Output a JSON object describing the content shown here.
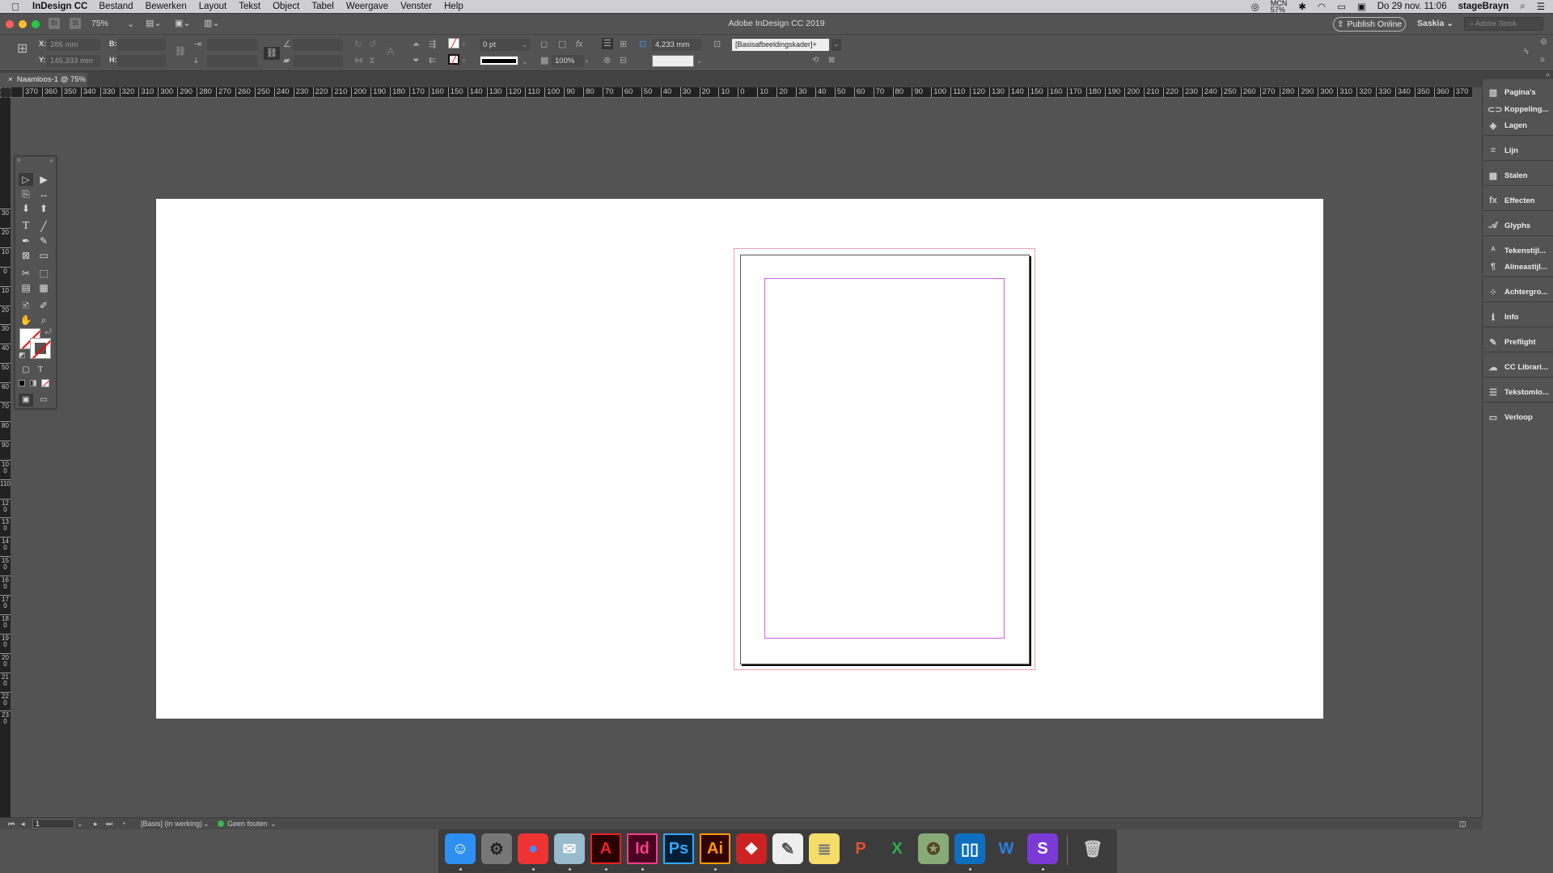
{
  "menubar": {
    "apple": "",
    "app": "InDesign CC",
    "items": [
      "Bestand",
      "Bewerken",
      "Layout",
      "Tekst",
      "Object",
      "Tabel",
      "Weergave",
      "Venster",
      "Help"
    ],
    "status": {
      "battery_top": "MCN",
      "battery_pct": "57%",
      "datetime": "Do 29 nov. 11:06",
      "user": "stageBrayn"
    }
  },
  "appbar": {
    "title": "Adobe InDesign CC 2019",
    "bridge": "Br",
    "stock": "St",
    "zoom": "75%",
    "publish": "Publish Online",
    "workspace": "Saskia",
    "search_placeholder": "Adobe Stock"
  },
  "control": {
    "x_label": "X:",
    "x_value": "286 mm",
    "y_label": "Y:",
    "y_value": "145,333 mm",
    "w_label": "B:",
    "h_label": "H:",
    "stroke_weight": "0 pt",
    "opacity": "100%",
    "gap": "4,233 mm",
    "object_style": "[Basisafbeeldingskader]+"
  },
  "tab": {
    "close": "×",
    "label": "Naamloos-1 @ 75%"
  },
  "ruler": {
    "h_ticks": [
      "370",
      "360",
      "350",
      "340",
      "330",
      "320",
      "310",
      "300",
      "290",
      "280",
      "270",
      "260",
      "250",
      "240",
      "230",
      "220",
      "210",
      "200",
      "190",
      "180",
      "170",
      "160",
      "150",
      "140",
      "130",
      "120",
      "110",
      "100",
      "90",
      "80",
      "70",
      "60",
      "50",
      "40",
      "30",
      "20",
      "10",
      "0",
      "10",
      "20",
      "30",
      "40",
      "50",
      "60",
      "70",
      "80",
      "90",
      "100",
      "110",
      "120",
      "130",
      "140",
      "150",
      "160",
      "170",
      "180",
      "190",
      "200",
      "210",
      "220",
      "230",
      "240",
      "250",
      "260",
      "270",
      "280",
      "290",
      "300",
      "310",
      "320",
      "330",
      "340",
      "350",
      "360",
      "370"
    ],
    "v_ticks": [
      "30",
      "20",
      "10",
      "0",
      "10",
      "20",
      "30",
      "40",
      "50",
      "60",
      "70",
      "80",
      "90",
      "100",
      "110",
      "120",
      "130",
      "140",
      "150",
      "160",
      "170",
      "180",
      "190",
      "200",
      "210",
      "220",
      "230"
    ]
  },
  "panels": [
    {
      "label": "Pagina's",
      "icon": "pages-icon",
      "glyph": "▥"
    },
    {
      "label": "Koppeling...",
      "icon": "links-icon",
      "glyph": "⊂⊃"
    },
    {
      "label": "Lagen",
      "icon": "layers-icon",
      "glyph": "◈"
    },
    {
      "label": "Lijn",
      "icon": "stroke-icon",
      "glyph": "≡"
    },
    {
      "label": "Stalen",
      "icon": "swatches-icon",
      "glyph": "▦"
    },
    {
      "label": "Effecten",
      "icon": "effects-icon",
      "glyph": "fx"
    },
    {
      "label": "Glyphs",
      "icon": "glyphs-icon",
      "glyph": "𝒜"
    },
    {
      "label": "Tekenstijl...",
      "icon": "character-styles-icon",
      "glyph": "ᴬ"
    },
    {
      "label": "Alineastijl...",
      "icon": "paragraph-styles-icon",
      "glyph": "¶"
    },
    {
      "label": "Achtergro...",
      "icon": "background-tasks-icon",
      "glyph": "⁘"
    },
    {
      "label": "Info",
      "icon": "info-icon",
      "glyph": "ℹ"
    },
    {
      "label": "Preflight",
      "icon": "preflight-icon",
      "glyph": "✎"
    },
    {
      "label": "CC Librari...",
      "icon": "cc-libraries-icon",
      "glyph": "☁"
    },
    {
      "label": "Tekstomlo...",
      "icon": "text-wrap-icon",
      "glyph": "☰"
    },
    {
      "label": "Verloop",
      "icon": "gradient-icon",
      "glyph": "▭"
    }
  ],
  "status": {
    "page": "1",
    "preflight_profile": "[Basis] (in werking)",
    "errors": "Geen fouten"
  },
  "dock": [
    {
      "name": "finder",
      "label": "☺",
      "bg": "#2d8ff0",
      "fg": "#fff"
    },
    {
      "name": "system-preferences",
      "label": "⚙",
      "bg": "#777",
      "fg": "#222"
    },
    {
      "name": "chrome",
      "label": "●",
      "bg": "#e33",
      "fg": "#4a8af4"
    },
    {
      "name": "mail",
      "label": "✉",
      "bg": "#9bc",
      "fg": "#fff"
    },
    {
      "name": "acrobat",
      "label": "A",
      "bg": "#2a0000",
      "fg": "#e22"
    },
    {
      "name": "indesign",
      "label": "Id",
      "bg": "#49021f",
      "fg": "#ff3d8b"
    },
    {
      "name": "photoshop",
      "label": "Ps",
      "bg": "#001e36",
      "fg": "#31a8ff"
    },
    {
      "name": "illustrator",
      "label": "Ai",
      "bg": "#330000",
      "fg": "#ff9a00"
    },
    {
      "name": "dictionary",
      "label": "❖",
      "bg": "#c22",
      "fg": "#fff"
    },
    {
      "name": "textedit",
      "label": "✎",
      "bg": "#eee",
      "fg": "#555"
    },
    {
      "name": "notes",
      "label": "≣",
      "bg": "#f6dd6a",
      "fg": "#777"
    },
    {
      "name": "powerpoint",
      "label": "P",
      "bg": "transparent",
      "fg": "#e5502a"
    },
    {
      "name": "excel",
      "label": "X",
      "bg": "transparent",
      "fg": "#2fb04a"
    },
    {
      "name": "preview-squirrel",
      "label": "✪",
      "bg": "#8a7",
      "fg": "#542"
    },
    {
      "name": "trello",
      "label": "▯▯",
      "bg": "#0f6fbf",
      "fg": "#fff"
    },
    {
      "name": "word",
      "label": "W",
      "bg": "transparent",
      "fg": "#2c7cdb"
    },
    {
      "name": "app-s",
      "label": "S",
      "bg": "#7b3ad6",
      "fg": "#fff"
    },
    {
      "name": "trash",
      "label": "🗑",
      "bg": "transparent",
      "fg": "#ccc"
    }
  ]
}
